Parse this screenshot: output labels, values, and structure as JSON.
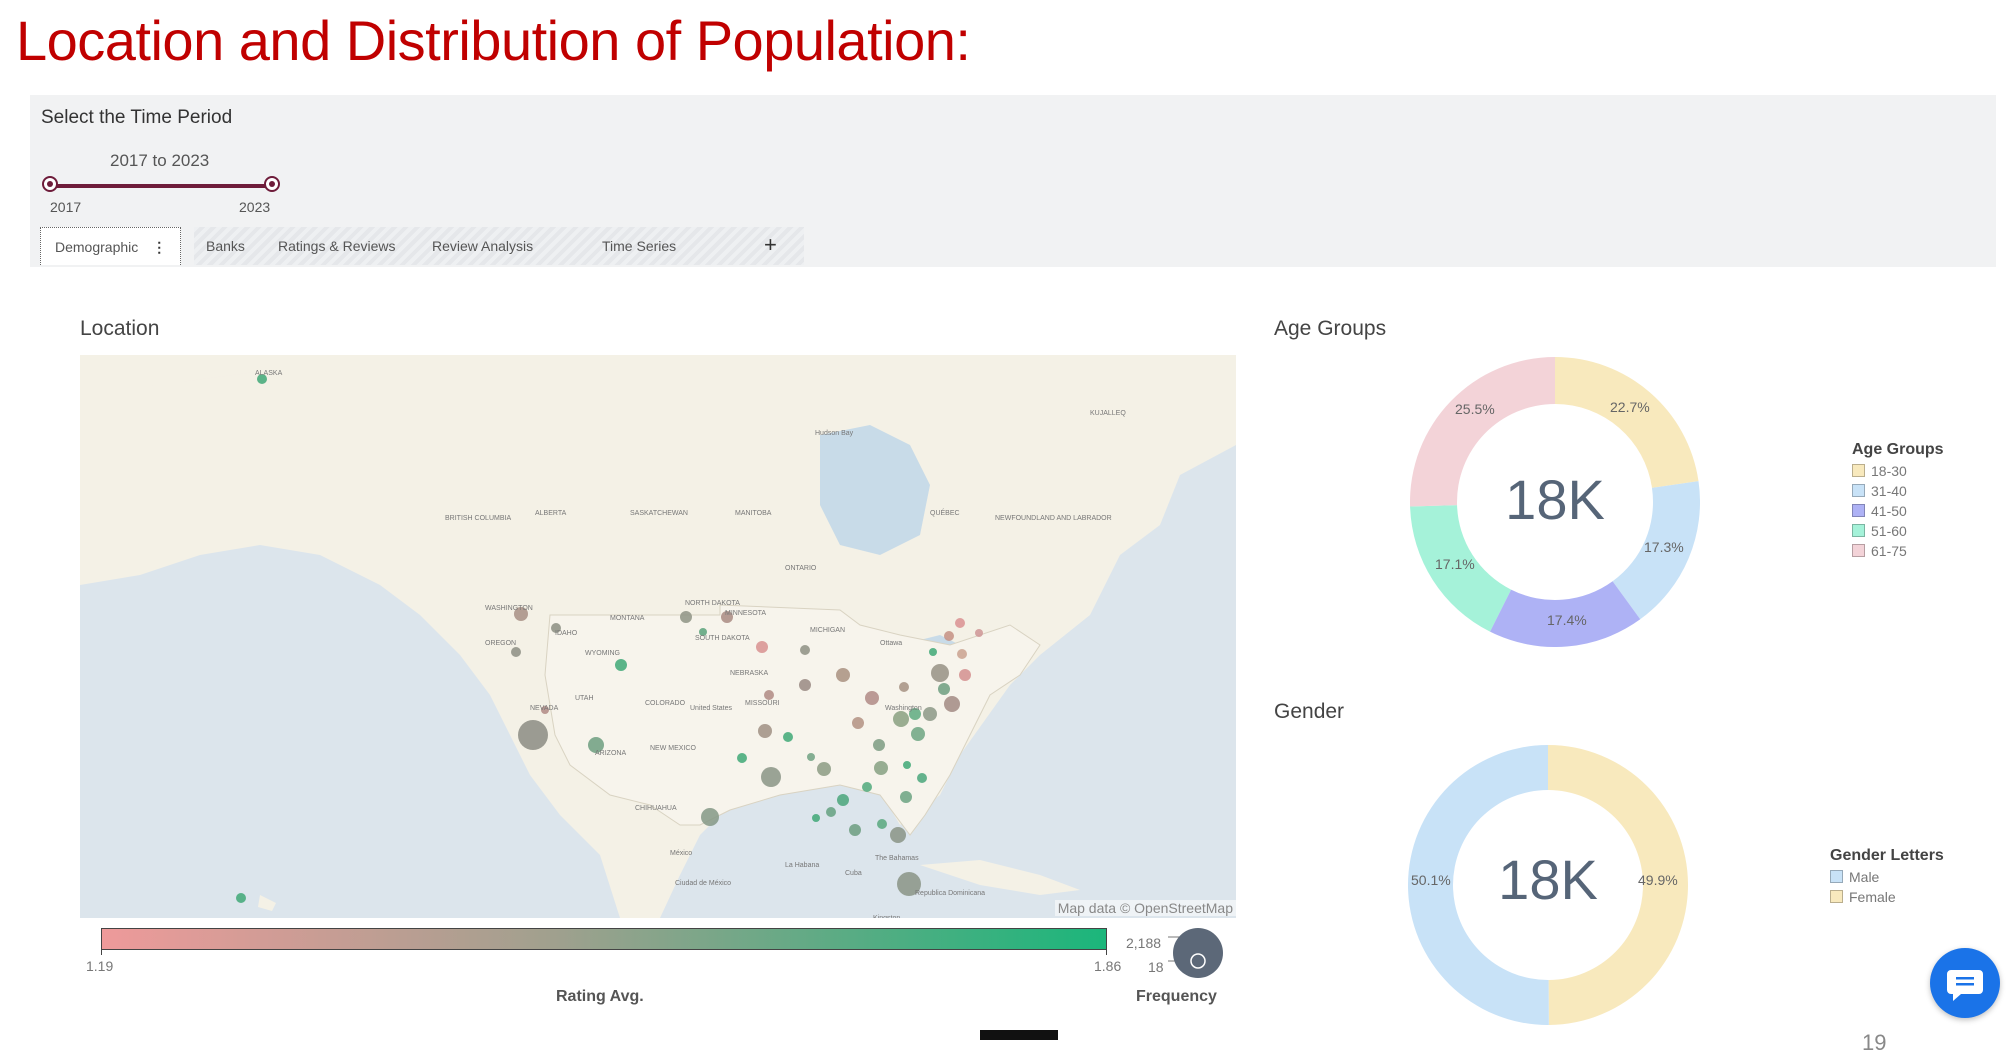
{
  "slide": {
    "title": "Location and Distribution of Population:",
    "page_number": "19"
  },
  "filter": {
    "label": "Select the Time Period",
    "range_text": "2017 to 2023",
    "min_label": "2017",
    "max_label": "2023",
    "selected_start": 2017,
    "selected_end": 2023
  },
  "tabs": [
    {
      "label": "Demographic",
      "active": true
    },
    {
      "label": "Banks",
      "active": false
    },
    {
      "label": "Ratings & Reviews",
      "active": false
    },
    {
      "label": "Review Analysis",
      "active": false
    },
    {
      "label": "Time Series",
      "active": false
    }
  ],
  "tab_add_label": "+",
  "location": {
    "title": "Location",
    "map_attribution": "Map data © OpenStreetMap",
    "map_labels": [
      "ALASKA",
      "BRITISH COLUMBIA",
      "ALBERTA",
      "SASKATCHEWAN",
      "MANITOBA",
      "ONTARIO",
      "QUÉBEC",
      "NEWFOUNDLAND AND LABRADOR",
      "KUJALLEQ",
      "Hudson Bay",
      "WASHINGTON",
      "MONTANA",
      "NORTH DAKOTA",
      "MINNESOTA",
      "OREGON",
      "IDAHO",
      "WYOMING",
      "SOUTH DAKOTA",
      "MICHIGAN",
      "NEBRASKA",
      "UTAH",
      "COLORADO",
      "NEVADA",
      "United States",
      "MISSOURI",
      "ARIZONA",
      "NEW MEXICO",
      "CHIHUAHUA",
      "México",
      "Ciudad de México",
      "La Habana",
      "Cuba",
      "The Bahamas",
      "Republica Dominicana",
      "Kingston",
      "Ottawa",
      "Washington"
    ],
    "color_legend": {
      "min": "1.19",
      "max": "1.86",
      "caption": "Rating Avg.",
      "color_low": "#ee9a9a",
      "color_high": "#1bb67b"
    },
    "size_legend": {
      "max": "2,188",
      "min": "18",
      "caption": "Frequency"
    }
  },
  "age_groups": {
    "title": "Age Groups",
    "center_value": "18K",
    "legend_title": "Age Groups",
    "slices": [
      {
        "label": "18-30",
        "pct": "22.7%",
        "value": 22.7,
        "color": "#f8e9bd"
      },
      {
        "label": "31-40",
        "pct": "17.3%",
        "value": 17.3,
        "color": "#c8e2f7"
      },
      {
        "label": "41-50",
        "pct": "17.4%",
        "value": 17.4,
        "color": "#aeb2f5"
      },
      {
        "label": "51-60",
        "pct": "17.1%",
        "value": 17.1,
        "color": "#a5f2d9"
      },
      {
        "label": "61-75",
        "pct": "25.5%",
        "value": 25.5,
        "color": "#f3d3d8"
      }
    ]
  },
  "gender": {
    "title": "Gender",
    "center_value": "18K",
    "legend_title": "Gender Letters",
    "slices": [
      {
        "label": "Male",
        "pct": "50.1%",
        "value": 50.1,
        "color": "#c8e2f7"
      },
      {
        "label": "Female",
        "pct": "49.9%",
        "value": 49.9,
        "color": "#f8e9bd"
      }
    ]
  },
  "icons": {
    "chat": "chat-bubble-icon",
    "kebab": "more-vertical-icon"
  }
}
